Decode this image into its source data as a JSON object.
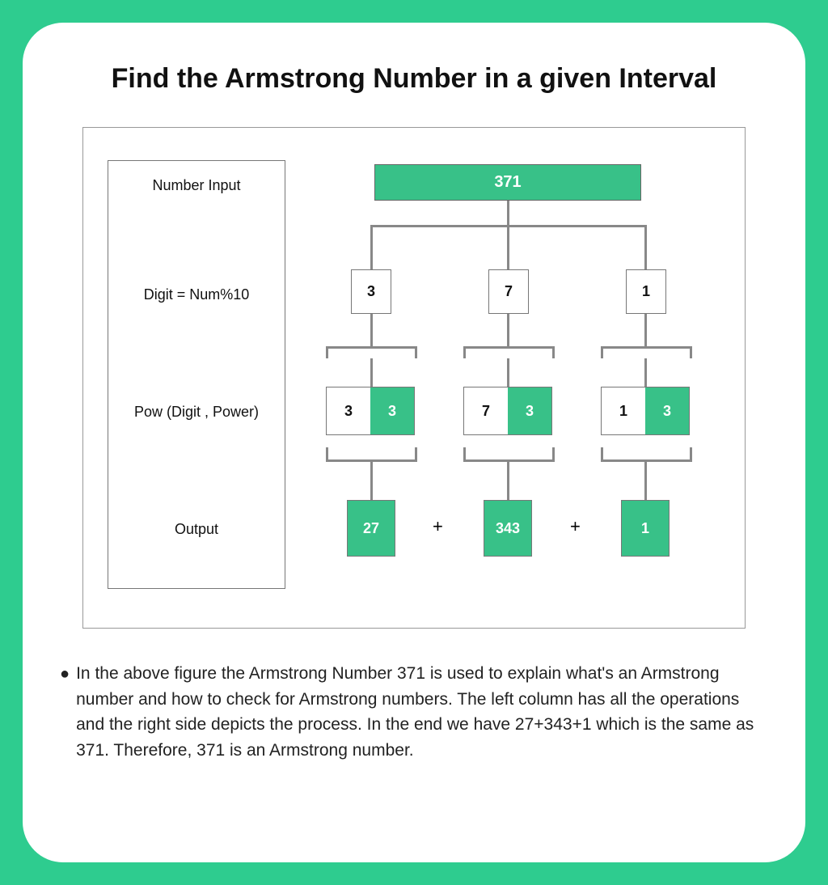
{
  "title": "Find the Armstrong Number in a given Interval",
  "legend": {
    "row1": "Number Input",
    "row2": "Digit = Num%10",
    "row3": "Pow (Digit , Power)",
    "row4": "Output"
  },
  "input_number": "371",
  "digits": {
    "d1": "3",
    "d2": "7",
    "d3": "1"
  },
  "pows": {
    "p1a": "3",
    "p1b": "3",
    "p2a": "7",
    "p2b": "3",
    "p3a": "1",
    "p3b": "3"
  },
  "outputs": {
    "o1": "27",
    "o2": "343",
    "o3": "1"
  },
  "plus": "+",
  "description": "In the above figure the Armstrong Number 371 is used to explain what's an Armstrong number and how to check for Armstrong numbers. The left column has all  the operations and the right side depicts the process. In the end we have 27+343+1 which is the same as 371. Therefore, 371 is an Armstrong number."
}
